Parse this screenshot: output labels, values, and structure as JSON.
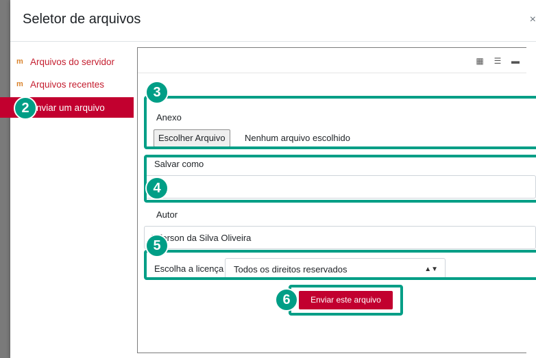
{
  "dialog": {
    "title": "Seletor de arquivos",
    "close_label": "×"
  },
  "sidebar": {
    "items": [
      {
        "label": "Arquivos do servidor",
        "icon": "moodle-icon"
      },
      {
        "label": "Arquivos recentes",
        "icon": "moodle-icon"
      },
      {
        "label": "Enviar um arquivo",
        "icon": "upload-icon",
        "active": true
      }
    ]
  },
  "viewbar": {
    "icons": [
      "grid-view-icon",
      "list-view-icon",
      "folder-view-icon"
    ]
  },
  "form": {
    "attachment_label": "Anexo",
    "choose_file_label": "Escolher Arquivo",
    "no_file_text": "Nenhum arquivo escolhido",
    "save_as_label": "Salvar como",
    "save_as_value": "",
    "author_label": "Autor",
    "author_value": "Jeferson da Silva Oliveira",
    "license_label": "Escolha a licença",
    "license_value": "Todos os direitos reservados",
    "submit_label": "Enviar este arquivo"
  },
  "badges": [
    "2",
    "3",
    "4",
    "5",
    "6"
  ],
  "colors": {
    "accent": "#c2002f",
    "highlight": "#009e86"
  }
}
